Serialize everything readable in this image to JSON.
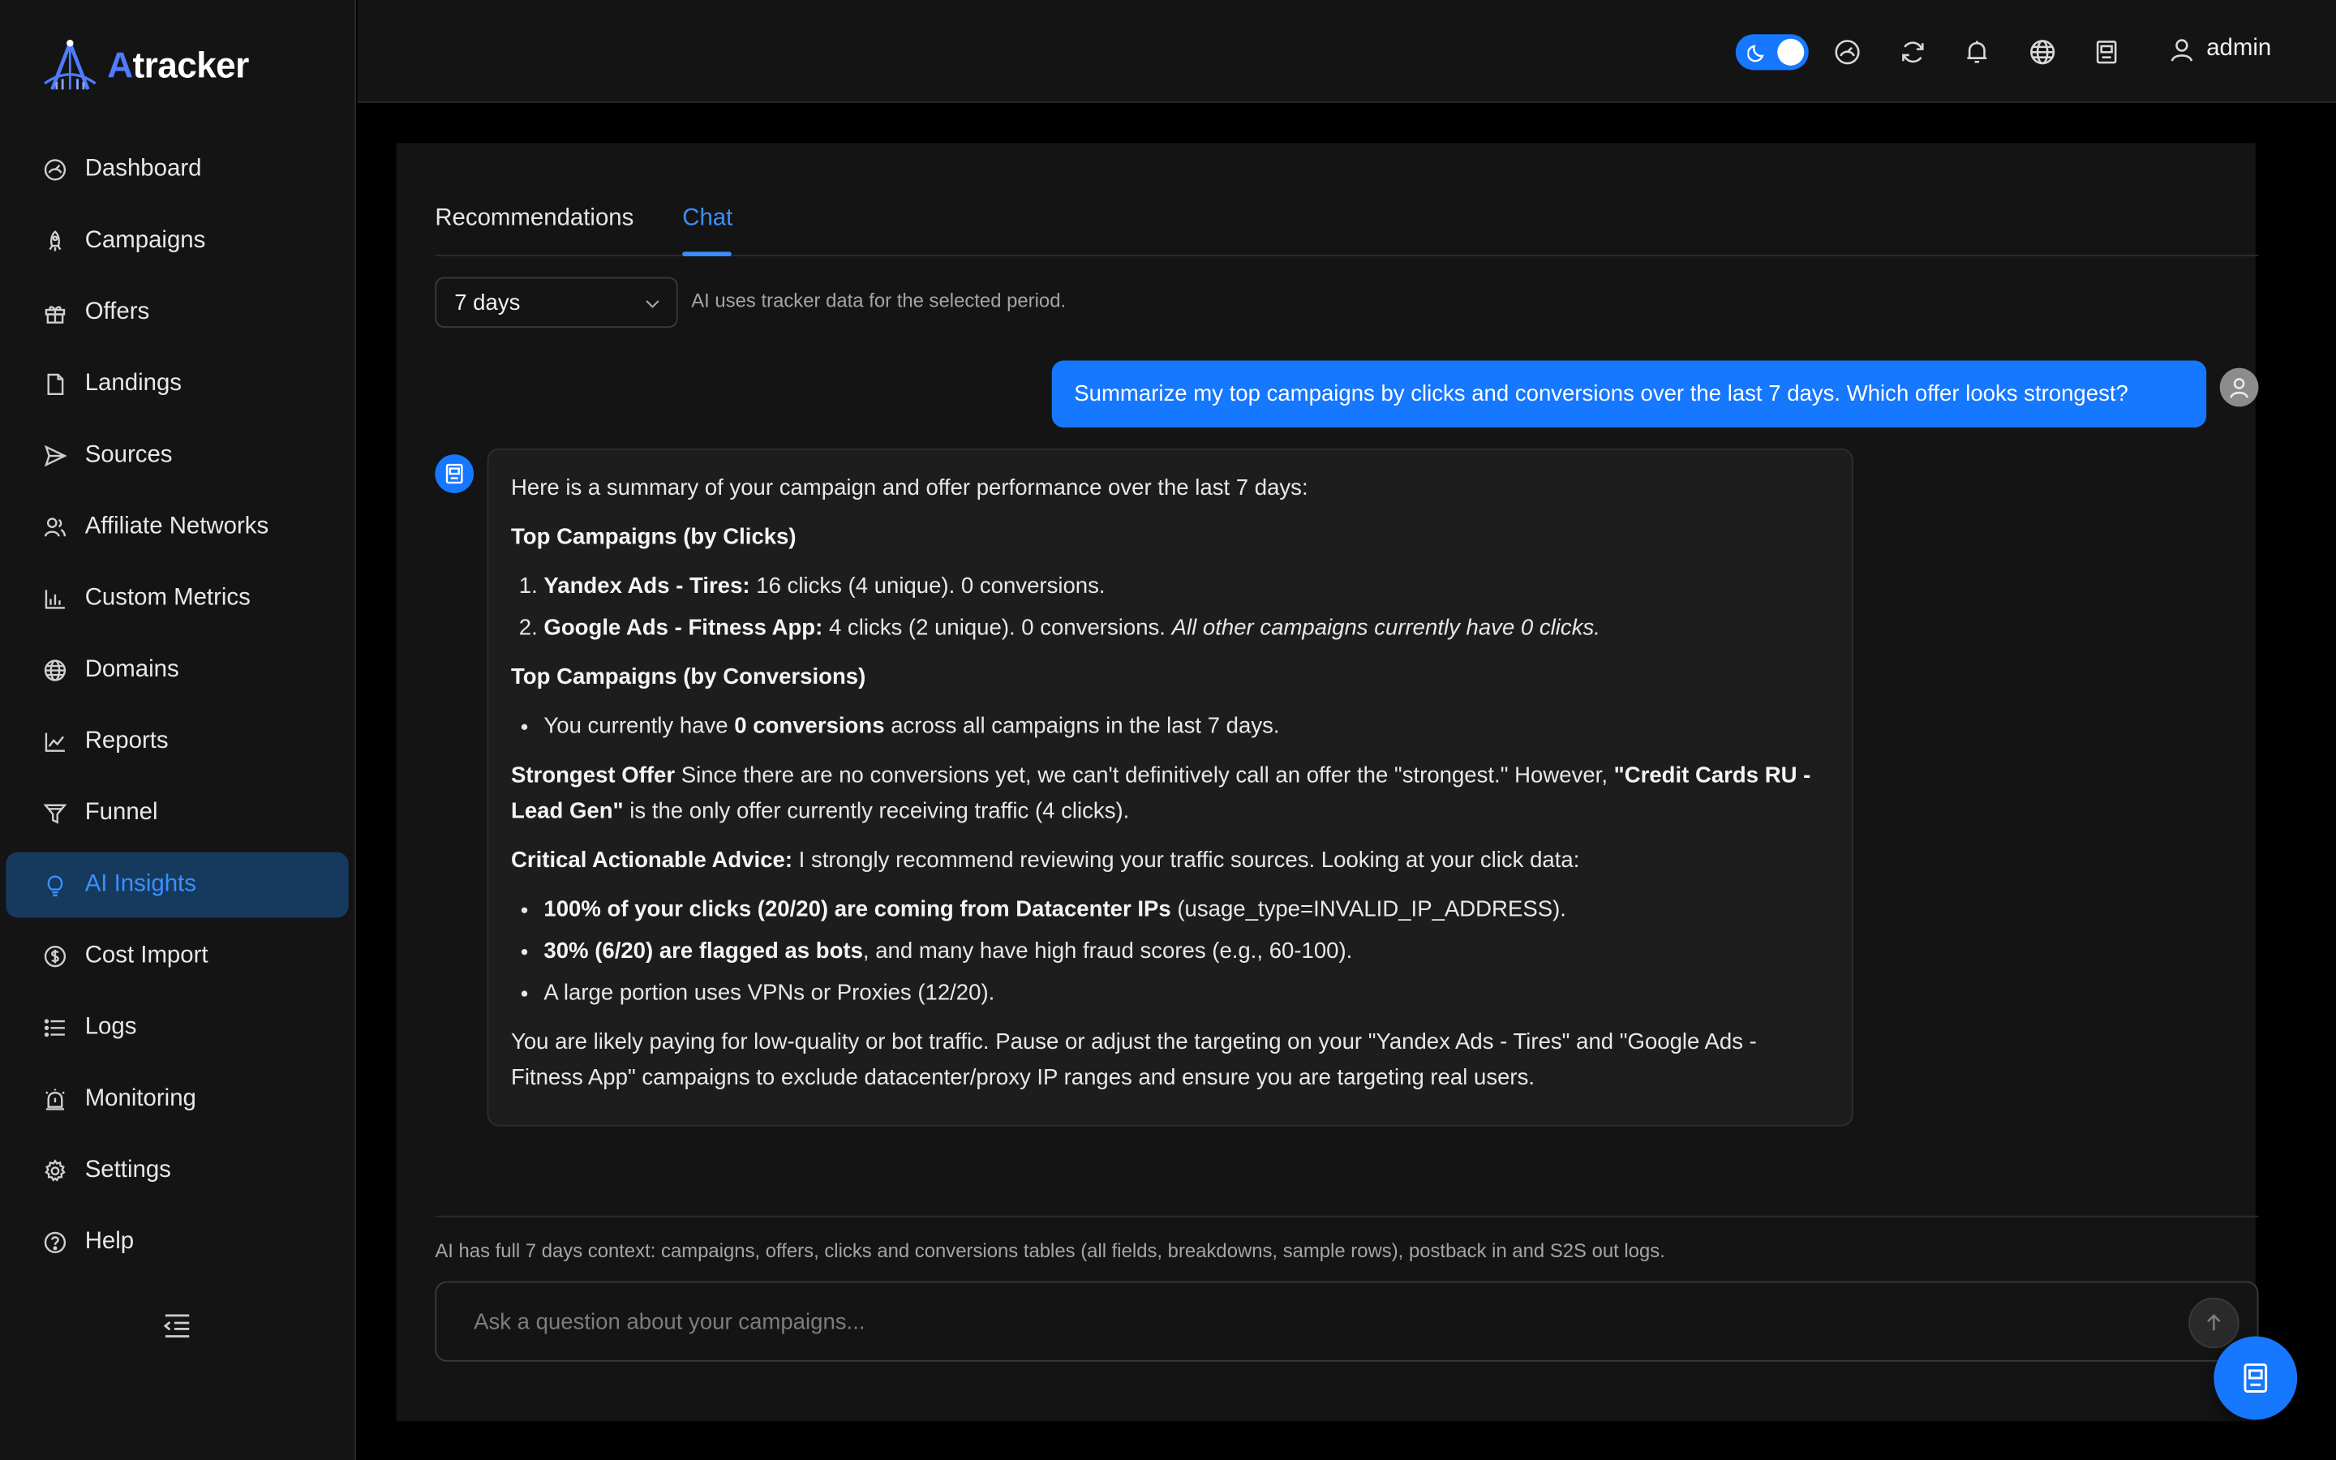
{
  "app": {
    "logo_text_rest": "tracker",
    "logo_text_a": "A",
    "accent_color": "#1677ff"
  },
  "sidebar": {
    "items": [
      {
        "label": "Dashboard",
        "icon": "gauge-icon"
      },
      {
        "label": "Campaigns",
        "icon": "rocket-icon"
      },
      {
        "label": "Offers",
        "icon": "gift-icon"
      },
      {
        "label": "Landings",
        "icon": "file-icon"
      },
      {
        "label": "Sources",
        "icon": "send-icon"
      },
      {
        "label": "Affiliate Networks",
        "icon": "users-icon"
      },
      {
        "label": "Custom Metrics",
        "icon": "bar-chart-icon"
      },
      {
        "label": "Domains",
        "icon": "globe-icon"
      },
      {
        "label": "Reports",
        "icon": "line-chart-icon"
      },
      {
        "label": "Funnel",
        "icon": "funnel-icon"
      },
      {
        "label": "AI Insights",
        "icon": "bulb-icon",
        "active": true
      },
      {
        "label": "Cost Import",
        "icon": "dollar-icon"
      },
      {
        "label": "Logs",
        "icon": "list-icon"
      },
      {
        "label": "Monitoring",
        "icon": "alarm-icon"
      },
      {
        "label": "Settings",
        "icon": "gear-icon"
      },
      {
        "label": "Help",
        "icon": "help-icon"
      }
    ]
  },
  "header": {
    "username": "admin"
  },
  "tabs": [
    {
      "label": "Recommendations",
      "active": false
    },
    {
      "label": "Chat",
      "active": true
    }
  ],
  "period": {
    "selected": "7 days",
    "note": "AI uses tracker data for the selected period."
  },
  "chat": {
    "user_message": "Summarize my top campaigns by clicks and conversions over the last 7 days. Which offer looks strongest?",
    "bot": {
      "intro": "Here is a summary of your campaign and offer performance over the last 7 days:",
      "clicks_heading": "Top Campaigns (by Clicks)",
      "c1_name": "Yandex Ads - Tires:",
      "c1_text": " 16 clicks (4 unique). 0 conversions.",
      "c2_name": "Google Ads - Fitness App:",
      "c2_text": " 4 clicks (2 unique). 0 conversions. ",
      "c2_note": "All other campaigns currently have 0 clicks.",
      "conv_heading": "Top Campaigns (by Conversions)",
      "conv_pre": "You currently have ",
      "conv_bold": "0 conversions",
      "conv_post": " across all campaigns in the last 7 days.",
      "offer_heading": "Strongest Offer",
      "offer_pre": " Since there are no conversions yet, we can't definitively call an offer the \"strongest.\" However, ",
      "offer_bold": "\"Credit Cards RU - Lead Gen\"",
      "offer_post": " is the only offer currently receiving traffic (4 clicks).",
      "advice_heading": "Critical Actionable Advice:",
      "advice_text": " I strongly recommend reviewing your traffic sources. Looking at your click data:",
      "b1_bold": "100% of your clicks (20/20) are coming from Datacenter IPs",
      "b1_text": " (usage_type=INVALID_IP_ADDRESS).",
      "b2_bold": "30% (6/20) are flagged as bots",
      "b2_text": ", and many have high fraud scores (e.g., 60-100).",
      "b3_text": "A large portion uses VPNs or Proxies (12/20).",
      "closing": "You are likely paying for low-quality or bot traffic. Pause or adjust the targeting on your \"Yandex Ads - Tires\" and \"Google Ads - Fitness App\" campaigns to exclude datacenter/proxy IP ranges and ensure you are targeting real users."
    },
    "context_note": "AI has full 7 days context: campaigns, offers, clicks and conversions tables (all fields, breakdowns, sample rows), postback in and S2S out logs.",
    "input_placeholder": "Ask a question about your campaigns..."
  }
}
